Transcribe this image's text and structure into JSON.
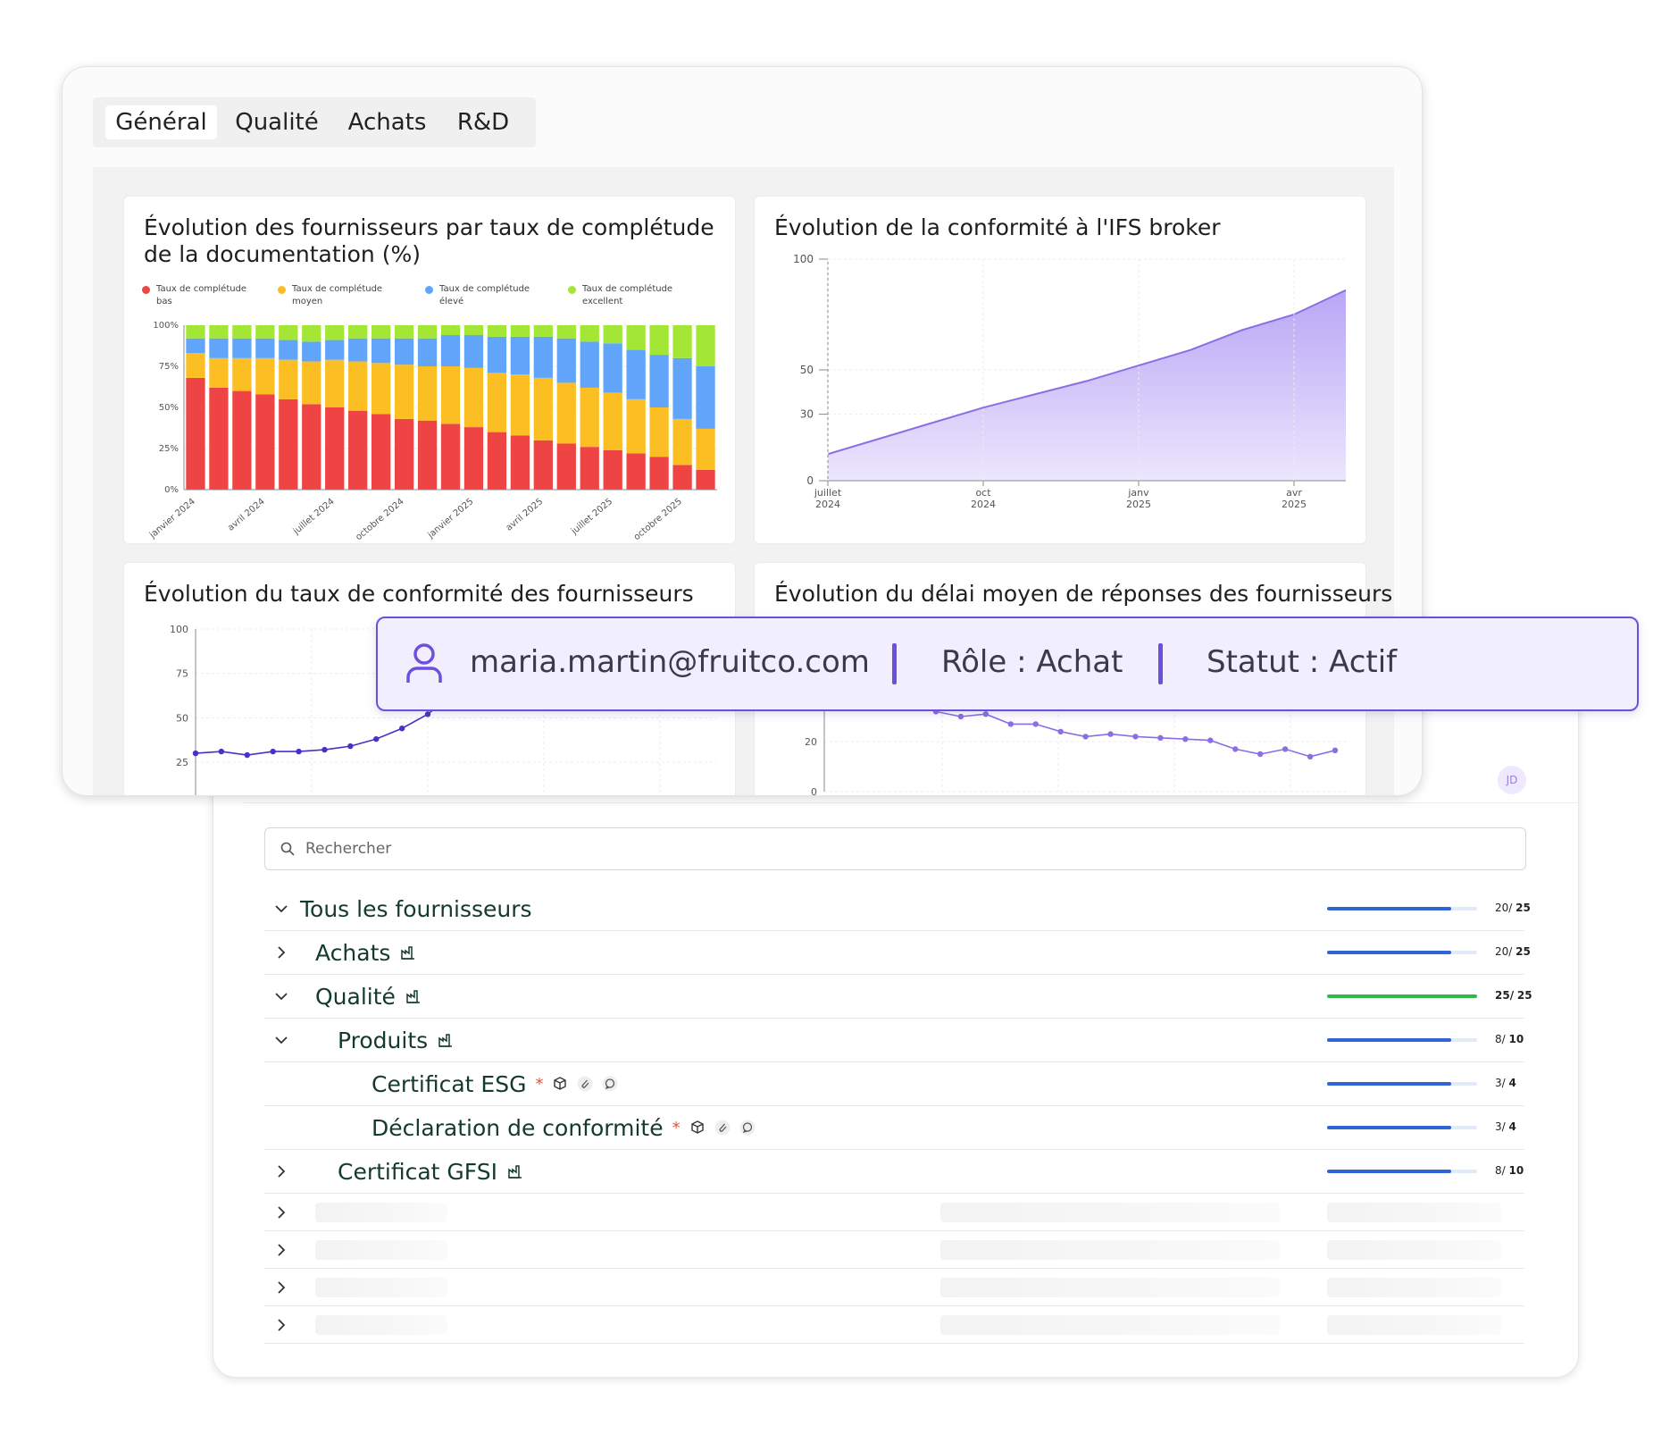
{
  "tabs": [
    {
      "label": "Général",
      "active": true
    },
    {
      "label": "Qualité",
      "active": false
    },
    {
      "label": "Achats",
      "active": false
    },
    {
      "label": "R&D",
      "active": false
    }
  ],
  "panels": {
    "doc_completion": {
      "title": "Évolution des fournisseurs par taux de complétude de la documentation (%)"
    },
    "ifs": {
      "title": "Évolution de la conformité à l'IFS broker"
    },
    "supplier_conformity": {
      "title": "Évolution du taux de conformité des fournisseurs"
    },
    "response_delay": {
      "title": "Évolution du délai moyen de réponses des fournisseurs"
    }
  },
  "chart_data": [
    {
      "type": "bar",
      "stacked": true,
      "legend_position": "top",
      "colors": [
        "#ef4444",
        "#fbbf24",
        "#60a5fa",
        "#a3e635"
      ],
      "categories": [
        "janvier 2024",
        "",
        "",
        "avril 2024",
        "",
        "",
        "juillet 2024",
        "",
        "",
        "octobre 2024",
        "",
        "",
        "janvier 2025",
        "",
        "",
        "avril 2025",
        "",
        "",
        "juillet 2025",
        "",
        "",
        "octobre 2025"
      ],
      "tick_labels": [
        "janvier 2024",
        "avril 2024",
        "juillet 2024",
        "octobre 2024",
        "janvier 2025",
        "avril 2025",
        "juillet 2025",
        "octobre 2025"
      ],
      "series": [
        {
          "name": "Taux de complétude bas",
          "values": [
            68,
            62,
            60,
            58,
            55,
            52,
            50,
            48,
            46,
            43,
            42,
            40,
            38,
            35,
            33,
            30,
            28,
            26,
            24,
            22,
            20,
            15,
            12
          ]
        },
        {
          "name": "Taux de complétude moyen",
          "values": [
            15,
            18,
            20,
            22,
            24,
            26,
            29,
            30,
            31,
            33,
            33,
            35,
            36,
            36,
            37,
            38,
            37,
            36,
            35,
            33,
            30,
            28,
            25
          ]
        },
        {
          "name": "Taux de complétude élevé",
          "values": [
            9,
            12,
            12,
            12,
            12,
            12,
            12,
            14,
            15,
            16,
            17,
            19,
            20,
            22,
            23,
            25,
            27,
            28,
            30,
            30,
            32,
            37,
            38
          ]
        },
        {
          "name": "Taux de complétude excellent",
          "values": [
            8,
            8,
            8,
            8,
            9,
            10,
            9,
            8,
            8,
            8,
            8,
            6,
            6,
            7,
            7,
            7,
            8,
            10,
            11,
            15,
            18,
            20,
            25
          ]
        }
      ],
      "yticks": [
        "0%",
        "25%",
        "50%",
        "75%",
        "100%"
      ],
      "ylim": [
        0,
        100
      ],
      "grid": true
    },
    {
      "type": "area",
      "color": "#8b6ee6",
      "x_ticks": [
        {
          "line1": "juillet",
          "line2": "2024"
        },
        {
          "line1": "oct",
          "line2": "2024"
        },
        {
          "line1": "janv",
          "line2": "2025"
        },
        {
          "line1": "avr",
          "line2": "2025"
        }
      ],
      "x": [
        "2024-07",
        "2024-08",
        "2024-09",
        "2024-10",
        "2024-11",
        "2024-12",
        "2025-01",
        "2025-02",
        "2025-03",
        "2025-04",
        "2025-05"
      ],
      "values": [
        12,
        19,
        26,
        33,
        39,
        45,
        52,
        59,
        68,
        75,
        86
      ],
      "yticks": [
        0,
        30,
        50,
        100
      ],
      "ylim": [
        0,
        100
      ],
      "grid": true
    },
    {
      "type": "line",
      "color": "#4b2fc9",
      "yticks": [
        25,
        50,
        75,
        100
      ],
      "ylim": [
        20,
        100
      ],
      "values": [
        30,
        31,
        29,
        31,
        31,
        32,
        34,
        38,
        44,
        52
      ],
      "grid": true
    },
    {
      "type": "line",
      "color": "#8b6ee6",
      "yticks": [
        0,
        20
      ],
      "values": [
        36,
        32,
        30,
        31,
        27,
        27,
        24,
        22,
        23,
        22,
        21.5,
        21,
        20.5,
        17,
        15,
        17,
        14,
        16.5
      ]
    }
  ],
  "user_banner": {
    "email": "maria.martin@fruitco.com",
    "role": "Rôle : Achat",
    "status": "Statut : Actif",
    "accent": "#6d4fdd"
  },
  "list": {
    "avatar_initials": "JD",
    "search_placeholder": "Rechercher",
    "rows": [
      {
        "label": "Tous les fournisseurs",
        "done": "20/",
        "total": "25",
        "progress": 0.8,
        "color": "#2f63d6"
      },
      {
        "label": "Achats",
        "done": "20/",
        "total": "25",
        "progress": 0.8,
        "color": "#2f63d6"
      },
      {
        "label": "Qualité",
        "done": "25/",
        "total": "25",
        "progress": 1.0,
        "color": "#2fb94a"
      },
      {
        "label": "Produits",
        "done": "8/",
        "total": "10",
        "progress": 0.8,
        "color": "#2f63d6"
      },
      {
        "label": "Certificat ESG",
        "done": "3/",
        "total": "4",
        "progress": 0.8,
        "color": "#2f63d6"
      },
      {
        "label": "Déclaration de conformité",
        "done": "3/",
        "total": "4",
        "progress": 0.8,
        "color": "#2f63d6"
      },
      {
        "label": "Certificat GFSI",
        "done": "8/",
        "total": "10",
        "progress": 0.8,
        "color": "#2f63d6"
      }
    ],
    "required_mark": "*"
  }
}
